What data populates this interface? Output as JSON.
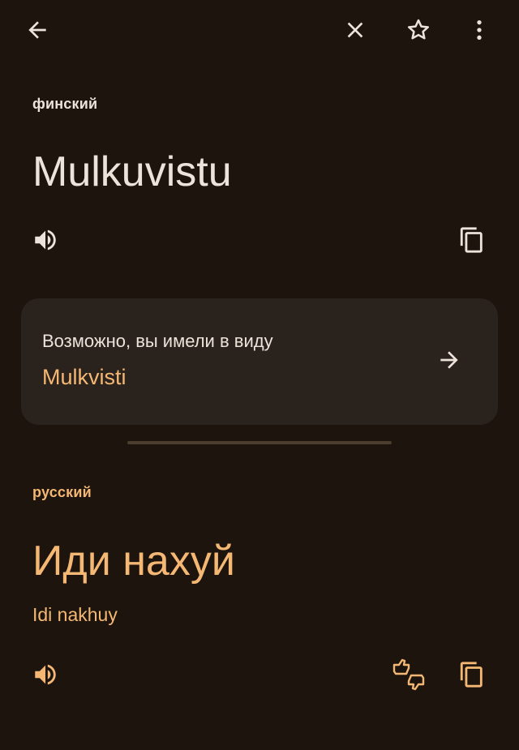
{
  "source": {
    "language": "финский",
    "text": "Mulkuvistu"
  },
  "suggestion": {
    "caption": "Возможно, вы имели в виду",
    "word": "Mulkvisti"
  },
  "target": {
    "language": "русский",
    "text": "Иди нахуй",
    "transliteration": "Idi nakhuy"
  },
  "colors": {
    "background": "#1c140d",
    "card": "#2a221c",
    "accent": "#f5b874",
    "text": "#ece4da"
  },
  "icons": {
    "back": "arrow-left-icon",
    "clear": "close-icon",
    "favorite": "star-outline-icon",
    "more": "more-vert-icon",
    "listen": "speaker-icon",
    "copy": "copy-icon",
    "suggest_go": "arrow-right-icon",
    "feedback": "thumbs-up-down-icon"
  }
}
